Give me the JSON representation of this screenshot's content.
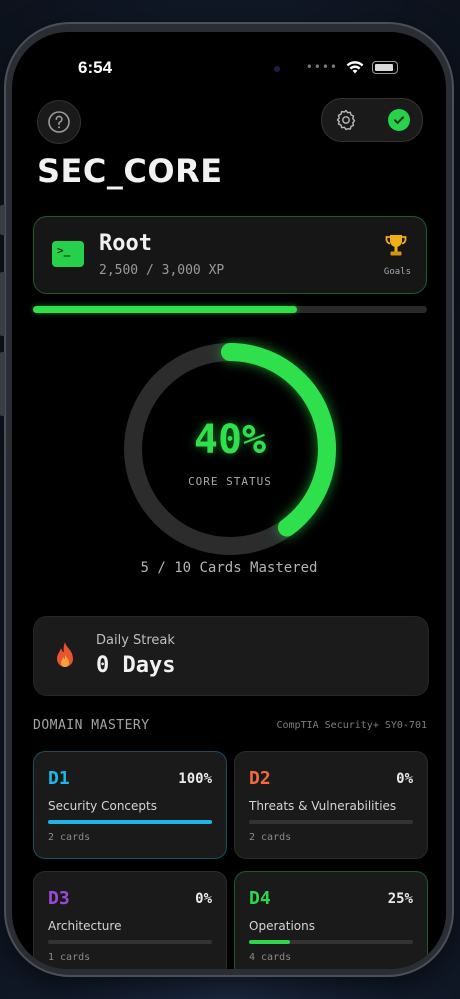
{
  "status": {
    "time": "6:54"
  },
  "header": {
    "title": "SEC_CORE",
    "help_icon": "question-circle-icon",
    "settings_icon": "gear-icon",
    "synced_icon": "check-circle-icon"
  },
  "rank": {
    "name": "Root",
    "xp": "2,500 / 3,000 XP",
    "goals_label": "Goals",
    "xp_progress": 0.67
  },
  "core": {
    "percent": "40%",
    "percent_value": 0.4,
    "label": "CORE STATUS",
    "mastered": "5 / 10 Cards Mastered"
  },
  "streak": {
    "label": "Daily Streak",
    "value": "0 Days"
  },
  "domain_mastery": {
    "title": "DOMAIN MASTERY",
    "subtitle": "CompTIA Security+ SY0-701",
    "items": [
      {
        "code": "D1",
        "percent": "100%",
        "name": "Security Concepts",
        "cards": "2 cards",
        "color": "#1fb6e6",
        "progress": 1.0
      },
      {
        "code": "D2",
        "percent": "0%",
        "name": "Threats & Vulnerabilities",
        "cards": "2 cards",
        "color": "#f26a3c",
        "progress": 0.0
      },
      {
        "code": "D3",
        "percent": "0%",
        "name": "Architecture",
        "cards": "1 cards",
        "color": "#9b49d6",
        "progress": 0.0
      },
      {
        "code": "D4",
        "percent": "25%",
        "name": "Operations",
        "cards": "4 cards",
        "color": "#2dd64a",
        "progress": 0.25
      }
    ]
  },
  "colors": {
    "accent": "#2de04c",
    "background": "#000000",
    "card": "#1a1a1b"
  }
}
